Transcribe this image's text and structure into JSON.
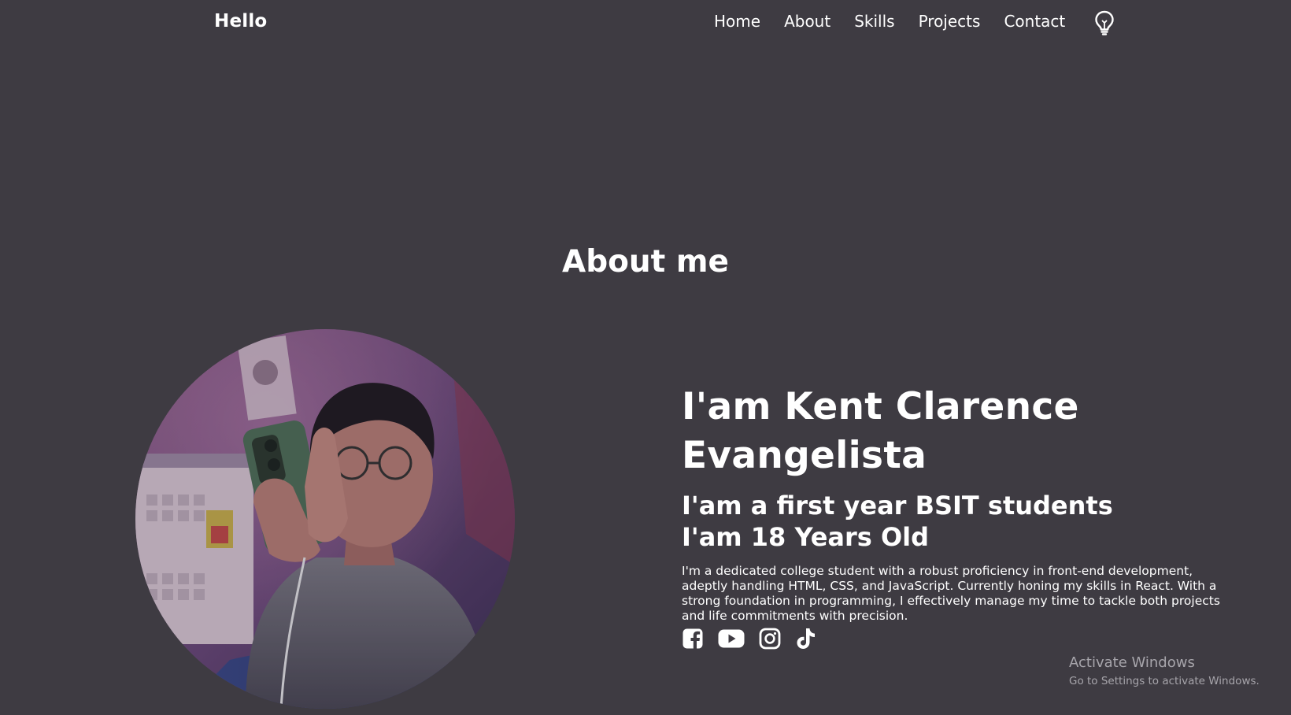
{
  "header": {
    "brand": "Hello",
    "nav": [
      "Home",
      "About",
      "Skills",
      "Projects",
      "Contact"
    ],
    "theme_toggle_icon": "lightbulb-icon"
  },
  "about": {
    "title": "About me",
    "name_line": "I'am Kent Clarence Evangelista",
    "year_line": "I'am a first year BSIT students",
    "age_line": "I'am 18 Years Old",
    "description": "I'm a dedicated college student with a robust proficiency in front-end development, adeptly handling HTML, CSS, and JavaScript. Currently honing my skills in React. With a strong foundation in programming, I effectively manage my time to tackle both projects and life commitments with precision.",
    "socials": [
      "facebook-icon",
      "youtube-icon",
      "instagram-icon",
      "tiktok-icon"
    ]
  },
  "watermark": {
    "title": "Activate Windows",
    "subtitle": "Go to Settings to activate Windows."
  },
  "colors": {
    "background": "#3e3b42",
    "text": "#ffffff",
    "watermark": "#a7a5ab"
  }
}
